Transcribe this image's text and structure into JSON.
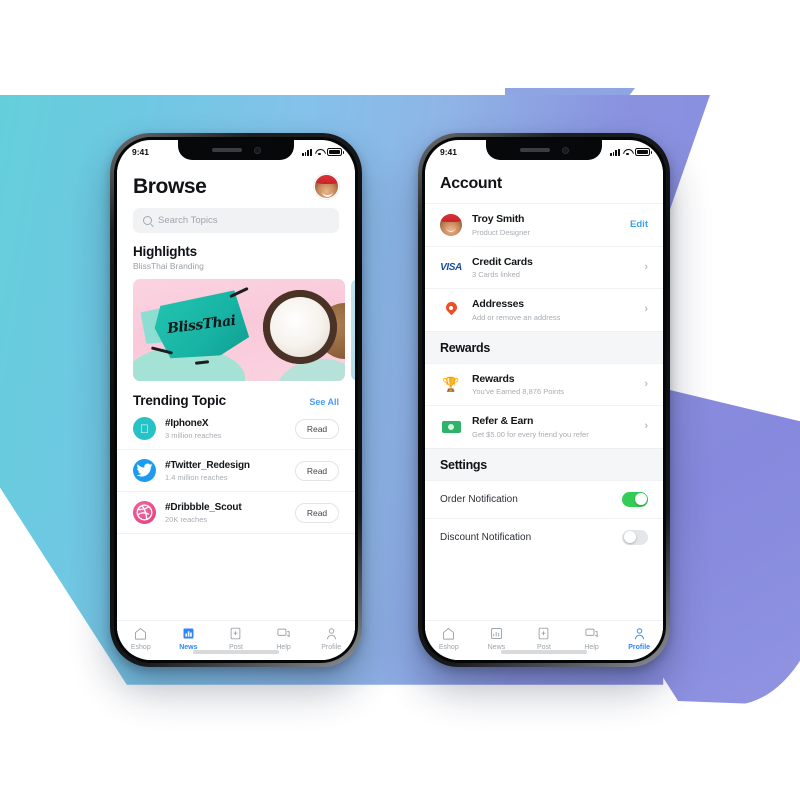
{
  "background": {
    "teal": "#63d0da",
    "blue": "#8a8ce0",
    "purple": "#8b8ede"
  },
  "phone1": {
    "status": {
      "time": "9:41",
      "signal_icon": "cellular-bars-icon",
      "wifi_icon": "wifi-icon",
      "battery_icon": "battery-icon"
    },
    "header": {
      "title": "Browse",
      "avatar_name": "user-avatar"
    },
    "search": {
      "placeholder": "Search Topics",
      "icon": "search-icon"
    },
    "highlights": {
      "title": "Highlights",
      "subtitle": "BlissThai Branding",
      "card_text": "BlissThai"
    },
    "trending": {
      "title": "Trending Topic",
      "see_all": "See All",
      "items": [
        {
          "icon": "apple-icon",
          "glyph": "",
          "name": "#IphoneX",
          "reaches": "3 million reaches",
          "action": "Read",
          "color": "#27c2c6"
        },
        {
          "icon": "twitter-icon",
          "glyph": "",
          "name": "#Twitter_Redesign",
          "reaches": "1.4 million reaches",
          "action": "Read",
          "color": "#1d9bf0"
        },
        {
          "icon": "dribbble-icon",
          "glyph": "",
          "name": "#Dribbble_Scout",
          "reaches": "20K reaches",
          "action": "Read",
          "color": "#ea4c89"
        }
      ]
    },
    "tabs": [
      {
        "label": "Eshop",
        "icon": "home-icon",
        "active": false
      },
      {
        "label": "News",
        "icon": "news-icon",
        "active": true
      },
      {
        "label": "Post",
        "icon": "post-icon",
        "active": false
      },
      {
        "label": "Help",
        "icon": "help-chat-icon",
        "active": false
      },
      {
        "label": "Profile",
        "icon": "profile-person-icon",
        "active": false
      }
    ],
    "active_tab": "News",
    "accent_color": "#2f86f7"
  },
  "phone2": {
    "status": {
      "time": "9:41",
      "signal_icon": "cellular-bars-icon",
      "wifi_icon": "wifi-icon",
      "battery_icon": "battery-icon"
    },
    "header": {
      "title": "Account"
    },
    "account_rows": [
      {
        "icon": "user-avatar",
        "name": "Troy Smith",
        "sub": "Product Designer",
        "action": "Edit",
        "action_type": "link"
      },
      {
        "icon": "visa-logo-icon",
        "icon_text": "VISA",
        "name": "Credit Cards",
        "sub": "3 Cards linked",
        "action": "›",
        "action_type": "chevron"
      },
      {
        "icon": "location-pin-icon",
        "name": "Addresses",
        "sub": "Add or remove an address",
        "action": "›",
        "action_type": "chevron"
      }
    ],
    "rewards_section": {
      "title": "Rewards",
      "rows": [
        {
          "icon": "trophy-icon",
          "icon_glyph": "🏆",
          "name": "Rewards",
          "sub": "You've Earned 8,876 Points",
          "action": "›"
        },
        {
          "icon": "money-bill-icon",
          "name": "Refer & Earn",
          "sub": "Get $5.00 for every friend you refer",
          "action": "›"
        }
      ]
    },
    "settings_section": {
      "title": "Settings",
      "rows": [
        {
          "label": "Order Notification",
          "toggle": "on"
        },
        {
          "label": "Discount Notification",
          "toggle": "off"
        }
      ]
    },
    "tabs": [
      {
        "label": "Eshop",
        "icon": "home-icon",
        "active": false
      },
      {
        "label": "News",
        "icon": "news-icon",
        "active": false
      },
      {
        "label": "Post",
        "icon": "post-icon",
        "active": false
      },
      {
        "label": "Help",
        "icon": "help-chat-icon",
        "active": false
      },
      {
        "label": "Profile",
        "icon": "profile-person-icon",
        "active": true
      }
    ],
    "active_tab": "Profile",
    "toggle_on_color": "#33cc56",
    "accent_color": "#2f86f7"
  }
}
